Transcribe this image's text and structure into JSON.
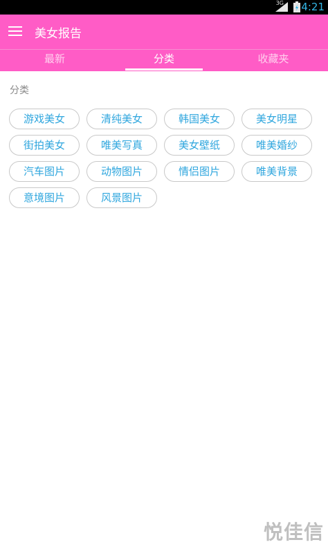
{
  "status_bar": {
    "network": "3G",
    "time": "4:21"
  },
  "app_bar": {
    "title": "美女报告"
  },
  "tabs": [
    {
      "label": "最新"
    },
    {
      "label": "分类"
    },
    {
      "label": "收藏夹"
    }
  ],
  "active_tab": "分类",
  "section": {
    "title": "分类"
  },
  "categories": [
    {
      "label": "游戏美女"
    },
    {
      "label": "清纯美女"
    },
    {
      "label": "韩国美女"
    },
    {
      "label": "美女明星"
    },
    {
      "label": "街拍美女"
    },
    {
      "label": "唯美写真"
    },
    {
      "label": "美女壁纸"
    },
    {
      "label": "唯美婚纱"
    },
    {
      "label": "汽车图片"
    },
    {
      "label": "动物图片"
    },
    {
      "label": "情侣图片"
    },
    {
      "label": "唯美背景"
    },
    {
      "label": "意境图片"
    },
    {
      "label": "风景图片"
    }
  ],
  "watermark": "悦佳信",
  "colors": {
    "accent": "#ff5cc6",
    "chip_text": "#2fa6de",
    "status_accent": "#33b5e5"
  }
}
